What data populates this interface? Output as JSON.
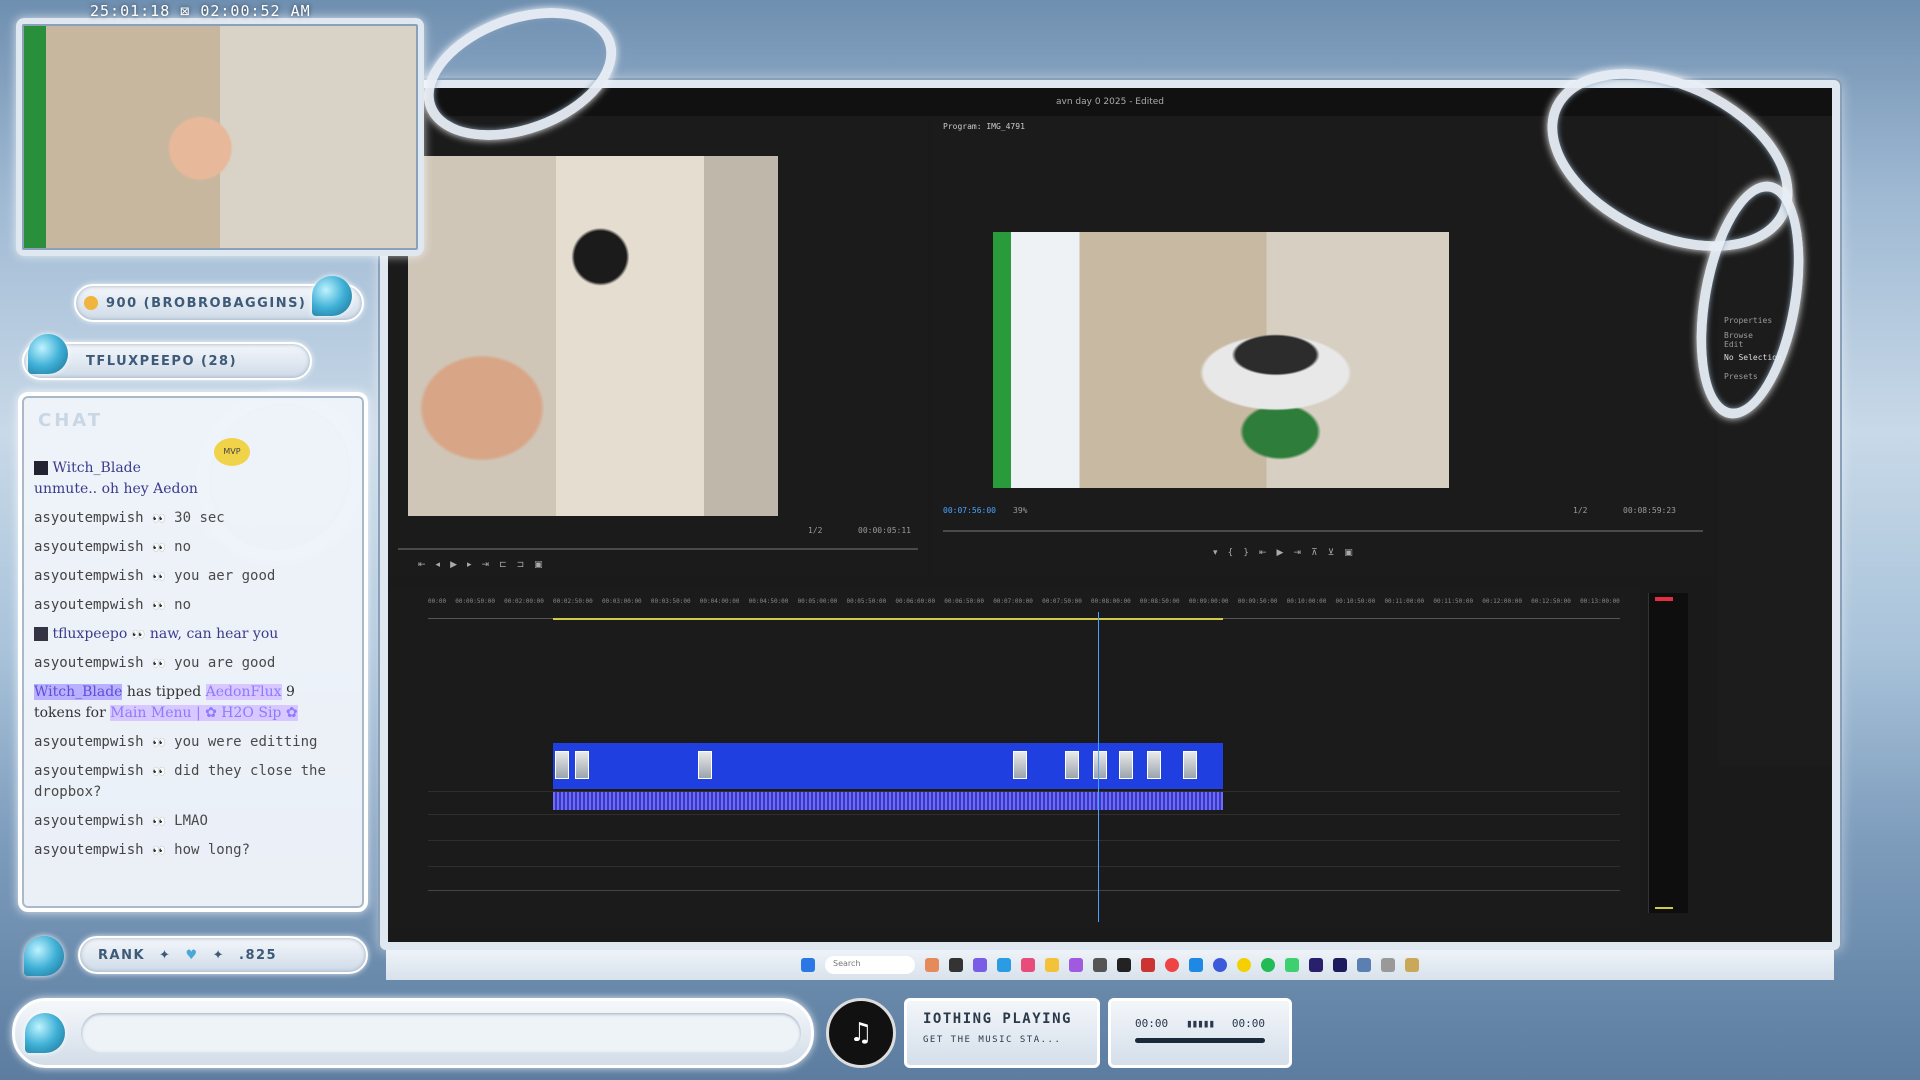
{
  "stream": {
    "timestamp": "25:01:18 ⊠ 02:00:52 AM"
  },
  "editor": {
    "title": "avn day 0 2025 - Edited",
    "source_time": "00:00:05:11",
    "source_zoom": "1/2",
    "program_label": "Program: IMG_4791",
    "program_timecode": "00:07:56:00",
    "program_zoom": "39%",
    "program_fraction": "1/2",
    "program_duration": "00:08:59:23",
    "side_panel": {
      "items": [
        "Properties",
        "Browse",
        "Edit",
        "No Selection",
        "Presets"
      ]
    },
    "ruler_ticks": [
      "00:00",
      "00:00:50:00",
      "00:02:00:00",
      "00:02:50:00",
      "00:03:00:00",
      "00:03:50:00",
      "00:04:00:00",
      "00:04:50:00",
      "00:05:00:00",
      "00:05:50:00",
      "00:06:00:00",
      "00:06:50:00",
      "00:07:00:00",
      "00:07:50:00",
      "00:08:00:00",
      "00:08:50:00",
      "00:09:00:00",
      "00:09:50:00",
      "00:10:00:00",
      "00:10:50:00",
      "00:11:00:00",
      "00:11:50:00",
      "00:12:00:00",
      "00:12:50:00",
      "00:13:00:00"
    ]
  },
  "pills": {
    "top": "900 (BROBROBAGGINS)",
    "second": "TFLUXPEEPO (28)"
  },
  "chat": {
    "header": "CHAT",
    "badge": "MVP",
    "messages": [
      {
        "user": "Witch_Blade",
        "text": "unmute.. oh hey Aedon",
        "style": "serif"
      },
      {
        "user": "asyoutempwish",
        "emote": "👀",
        "text": "30 sec"
      },
      {
        "user": "asyoutempwish",
        "emote": "👀",
        "text": "no"
      },
      {
        "user": "asyoutempwish",
        "emote": "👀",
        "text": "you aer good"
      },
      {
        "user": "asyoutempwish",
        "emote": "👀",
        "text": "no"
      },
      {
        "user": "tfluxpeepo",
        "emote": "👀",
        "text": "naw, can hear you",
        "style": "serif"
      },
      {
        "user": "asyoutempwish",
        "emote": "👀",
        "text": "you are good"
      },
      {
        "user": "asyoutempwish",
        "emote": "👀",
        "text": "you were editting"
      },
      {
        "user": "asyoutempwish",
        "emote": "👀",
        "text": "did they close the dropbox?"
      },
      {
        "user": "asyoutempwish",
        "emote": "👀",
        "text": "LMAO"
      },
      {
        "user": "asyoutempwish",
        "emote": "👀",
        "text": "how long?"
      }
    ],
    "tip": {
      "tipper": "Witch_Blade",
      "mid": "has tipped",
      "recipient": "AedonFlux",
      "amount": "9",
      "tokens_for": "tokens for",
      "item": "Main Menu | ✿ H2O Sip ✿"
    }
  },
  "rank": {
    "label": "RANK",
    "sep1": "✦",
    "sep2": "✦",
    "value": ".825"
  },
  "music": {
    "title": "IOTHING PLAYING",
    "subtitle": "GET THE MUSIC STA...",
    "time_start": "00:00",
    "time_end": "00:00",
    "progress": 0.0
  },
  "taskbar": {
    "search_placeholder": "Search"
  },
  "colors": {
    "accent": "#4aa3ff",
    "clip_video": "#1f3fe0",
    "clip_audio": "#6b6bff",
    "chrome": "#dfe7f0"
  }
}
